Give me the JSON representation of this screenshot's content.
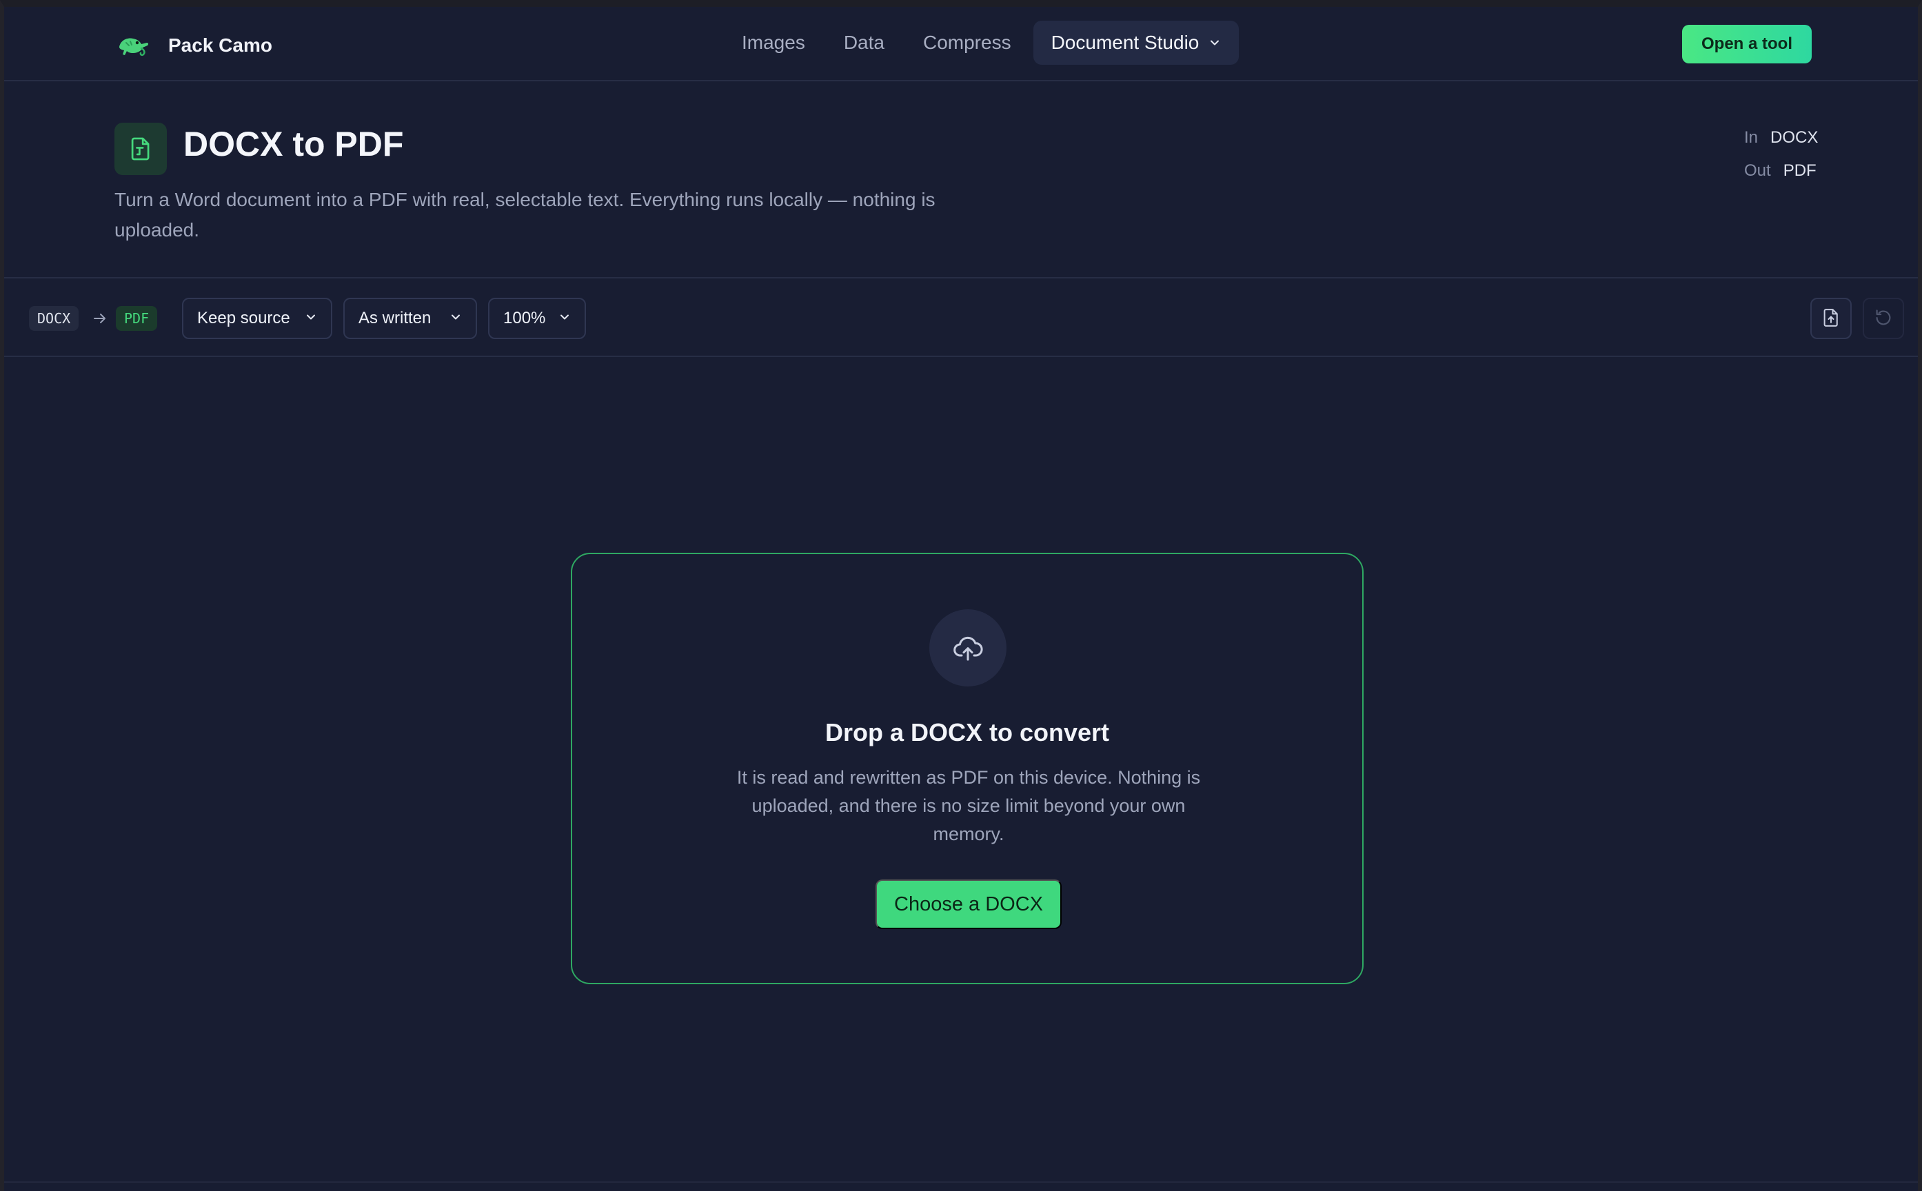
{
  "brand": {
    "name": "Pack Camo",
    "logo_icon": "chameleon-icon"
  },
  "nav": {
    "items": [
      {
        "label": "Images"
      },
      {
        "label": "Data"
      },
      {
        "label": "Compress"
      }
    ],
    "active": {
      "label": "Document Studio",
      "icon": "chevron-down-icon"
    }
  },
  "header_cta": {
    "label": "Open a tool"
  },
  "tool": {
    "icon": "file-convert-icon",
    "title": "DOCX to PDF",
    "description": "Turn a Word document into a PDF with real, selectable text. Everything runs locally — nothing is uploaded.",
    "io": {
      "in_key": "In",
      "in_value": "DOCX",
      "out_key": "Out",
      "out_value": "PDF"
    }
  },
  "toolbar": {
    "from_chip": "DOCX",
    "to_chip": "PDF",
    "selects": [
      {
        "value": "Keep source"
      },
      {
        "value": "As written"
      },
      {
        "value": "100%"
      }
    ],
    "export_icon": "file-upload-icon",
    "reset_icon": "reset-icon"
  },
  "dropzone": {
    "icon": "cloud-upload-icon",
    "title": "Drop a DOCX to convert",
    "text": "It is read and rewritten as PDF on this device. Nothing is uploaded, and there is no size limit beyond your own memory.",
    "button": "Choose a DOCX"
  },
  "colors": {
    "background": "#181d32",
    "accent": "#3fd87e",
    "accent_gradient_end": "#2ed8a0",
    "border": "#272d45"
  }
}
